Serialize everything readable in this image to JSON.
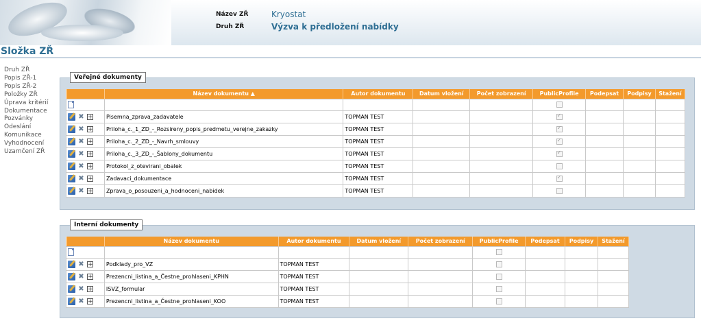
{
  "header": {
    "nazev_label": "Název ZŘ",
    "nazev_value": "Kryostat",
    "druh_label": "Druh ZŘ",
    "druh_value": "Výzva k předložení nabídky"
  },
  "page_title": "Složka ZŘ",
  "sidebar": {
    "items": [
      {
        "label": "Druh ZŘ"
      },
      {
        "label": "Popis ZŘ-1"
      },
      {
        "label": "Popis ZŘ-2"
      },
      {
        "label": "Položky ZŘ"
      },
      {
        "label": "Úprava kritérií"
      },
      {
        "label": "Dokumentace"
      },
      {
        "label": "Pozvánky"
      },
      {
        "label": "Odeslání"
      },
      {
        "label": "Komunikace"
      },
      {
        "label": "Vyhodnocení"
      },
      {
        "label": "Uzamčení ZŘ"
      }
    ]
  },
  "public_docs": {
    "legend": "Veřejné dokumenty",
    "columns": {
      "name": "Název dokumentu ▲",
      "author": "Autor dokumentu",
      "date": "Datum vložení",
      "views": "Počet zobrazení",
      "public": "PublicProfile",
      "sign": "Podepsat",
      "signatures": "Podpisy",
      "downloads": "Stažení"
    },
    "rows": [
      {
        "name": "Pisemna_zprava_zadavatele",
        "author": "TOPMAN TEST",
        "public": true
      },
      {
        "name": "Priloha_c._1_ZD_-_Rozsireny_popis_predmetu_verejne_zakazky",
        "author": "TOPMAN TEST",
        "public": true
      },
      {
        "name": "Priloha_c._2_ZD_-_Navrh_smlouvy",
        "author": "TOPMAN TEST",
        "public": true
      },
      {
        "name": "Priloha_c._3_ZD_-_Šablony_dokumentu",
        "author": "TOPMAN TEST",
        "public": true
      },
      {
        "name": "Protokol_z_otevirani_obalek",
        "author": "TOPMAN TEST",
        "public": false
      },
      {
        "name": "Zadavaci_dokumentace",
        "author": "TOPMAN TEST",
        "public": true
      },
      {
        "name": "Zprava_o_posouzeni_a_hodnoceni_nabidek",
        "author": "TOPMAN TEST",
        "public": false
      }
    ]
  },
  "internal_docs": {
    "legend": "Interní dokumenty",
    "columns": {
      "name": "Název dokumentu",
      "author": "Autor dokumentu",
      "date": "Datum vložení",
      "views": "Počet zobrazení",
      "public": "PublicProfile",
      "sign": "Podepsat",
      "signatures": "Podpisy",
      "downloads": "Stažení"
    },
    "rows": [
      {
        "name": "Podklady_pro_VZ",
        "author": "TOPMAN TEST",
        "public": false
      },
      {
        "name": "Prezencni_listina_a_Čestne_prohlaseni_KPHN",
        "author": "TOPMAN TEST",
        "public": false
      },
      {
        "name": "ISVZ_formular",
        "author": "TOPMAN TEST",
        "public": false
      },
      {
        "name": "Prezencni_listina_a_Čestne_prohlaseni_KOO",
        "author": "TOPMAN TEST",
        "public": false
      }
    ]
  }
}
